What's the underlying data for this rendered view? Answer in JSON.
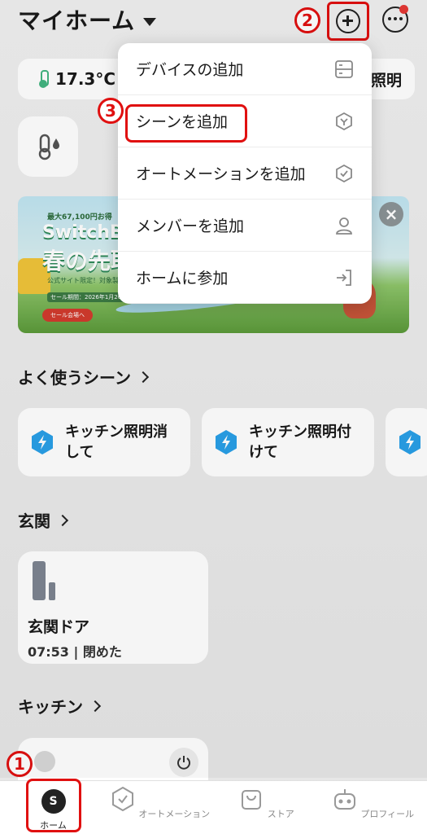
{
  "header": {
    "title": "マイホーム"
  },
  "weather": {
    "temperature": "17.3°C",
    "right_chip": "照明"
  },
  "banner": {
    "title": "SwitchB",
    "subtitle": "春の先取",
    "price_tag": "最大67,100円お得",
    "note": "公式サイト限定！対象製品のご購",
    "period": "セール期間：2026年1月20日",
    "cta": "セール会場へ"
  },
  "menu": {
    "items": [
      {
        "label": "デバイスの追加",
        "icon": "device-list-icon"
      },
      {
        "label": "シーンを追加",
        "icon": "scene-icon"
      },
      {
        "label": "オートメーションを追加",
        "icon": "automation-check-icon"
      },
      {
        "label": "メンバーを追加",
        "icon": "person-icon"
      },
      {
        "label": "ホームに参加",
        "icon": "join-home-icon"
      }
    ]
  },
  "sections": {
    "favorite_scenes": "よく使うシーン",
    "entrance": "玄関",
    "kitchen": "キッチン"
  },
  "scenes": [
    {
      "label": "キッチン照明消して"
    },
    {
      "label": "キッチン照明付けて"
    }
  ],
  "device": {
    "name": "玄関ドア",
    "status": "07:53 | 閉めた"
  },
  "tabs": [
    {
      "label": "ホーム",
      "icon": "home-s-icon",
      "active": true
    },
    {
      "label": "オートメーション",
      "icon": "automation-icon",
      "active": false
    },
    {
      "label": "ストア",
      "icon": "store-icon",
      "active": false
    },
    {
      "label": "プロフィール",
      "icon": "robot-profile-icon",
      "active": false
    }
  ],
  "annotations": {
    "badge1": "1",
    "badge2": "2",
    "badge3": "3"
  },
  "colors": {
    "accent_red": "#e01010",
    "scene_blue": "#29a0e8",
    "thermo_green": "#43b581"
  }
}
